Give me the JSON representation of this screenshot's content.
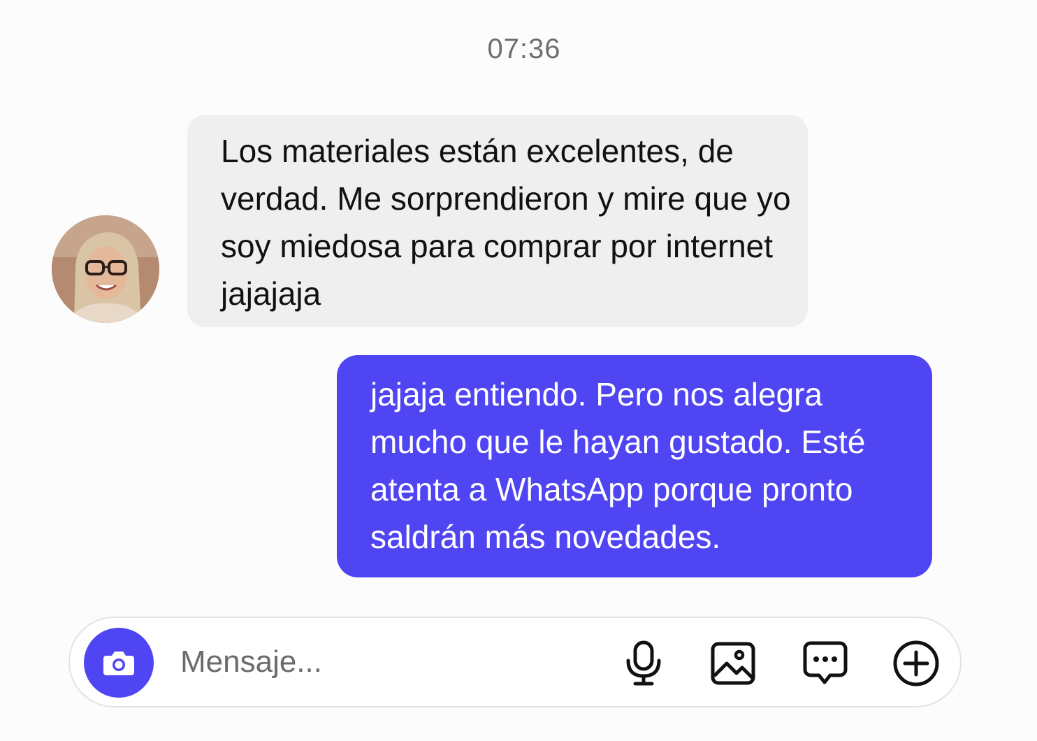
{
  "chat": {
    "timestamp": "07:36",
    "messages": [
      {
        "direction": "incoming",
        "text": "Los materiales están excelentes, de verdad. Me sorprendieron y mire que yo soy miedosa para comprar por internet jajajaja"
      },
      {
        "direction": "outgoing",
        "text": "jajaja entiendo. Pero nos alegra mucho que le hayan gustado. Esté atenta a WhatsApp porque pronto saldrán más novedades."
      }
    ]
  },
  "composer": {
    "placeholder": "Mensaje...",
    "value": ""
  },
  "icons": {
    "camera": "camera-icon",
    "microphone": "microphone-icon",
    "gallery": "image-icon",
    "sticker": "chat-bubble-icon",
    "more": "plus-circle-icon"
  },
  "colors": {
    "accent": "#4f45f2",
    "incoming_bubble": "#efeff0",
    "background": "#fcfcfc"
  }
}
